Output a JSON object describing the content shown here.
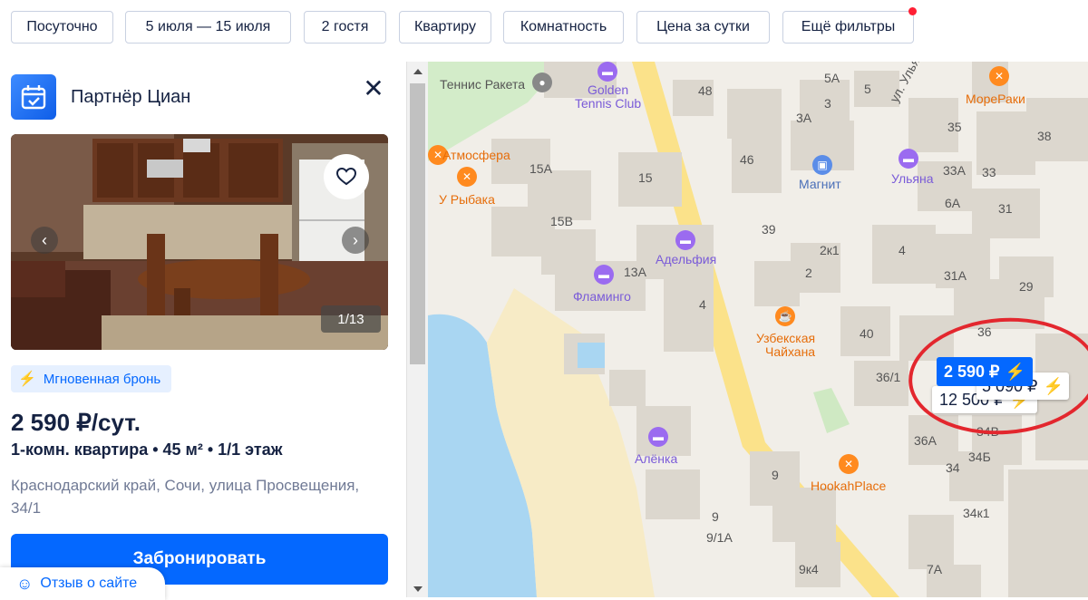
{
  "filters": {
    "daily": "Посуточно",
    "dates": "5 июля — 15 июля",
    "guests": "2 гостя",
    "type": "Квартиру",
    "rooms": "Комнатность",
    "price": "Цена за сутки",
    "more": "Ещё фильтры"
  },
  "card": {
    "partner": "Партнёр Циан",
    "photo_counter": "1/13",
    "badge": "Мгновенная бронь",
    "price": "2 590 ₽/сут.",
    "params": "1-комн. квартира  •  45 м²  •  1/1 этаж",
    "address": "Краснодарский край, Сочи, улица Просвещения, 34/1",
    "book_label": "Забронировать"
  },
  "feedback": {
    "label": "Отзыв о сайте"
  },
  "map": {
    "markers": {
      "main": "2 590 ₽",
      "secondary": "5 090 ₽",
      "tertiary": "12 500 ₽"
    },
    "pois": {
      "tennis": "Теннис Ракета",
      "golden_1": "Golden",
      "golden_2": "Tennis Club",
      "atmosfera": "Атмосфера",
      "rybaka": "У Рыбака",
      "adelfia": "Адельфия",
      "flamingo": "Фламинго",
      "alenka": "Алёнка",
      "magnit": "Магнит",
      "ulyana": "Ульяна",
      "moreraki": "МореРаки",
      "chaihana_1": "Узбекская",
      "chaihana_2": "Чайхана",
      "hookah": "HookahPlace",
      "street": "ул. Ульян"
    },
    "houses": {
      "h48": "48",
      "h5a": "5А",
      "h5": "5",
      "h3": "3",
      "h3a": "3А",
      "h35": "35",
      "h38": "38",
      "h15a": "15А",
      "h15": "15",
      "h15v": "15В",
      "h46": "46",
      "h33a": "33А",
      "h33": "33",
      "h6a": "6А",
      "h31": "31",
      "h39": "39",
      "h2k1": "2к1",
      "h2": "2",
      "h4a": "4",
      "h31a": "31А",
      "h29": "29",
      "h13a": "13А",
      "h4b": "4",
      "h40": "40",
      "h36": "36",
      "h361": "36/1",
      "h36a": "36А",
      "h34v": "34В",
      "h34b": "34Б",
      "h34": "34",
      "h34k1": "34к1",
      "h9": "9",
      "h9b": "9",
      "h91a": "9/1А",
      "h9k4": "9к4",
      "h7a": "7А"
    }
  }
}
